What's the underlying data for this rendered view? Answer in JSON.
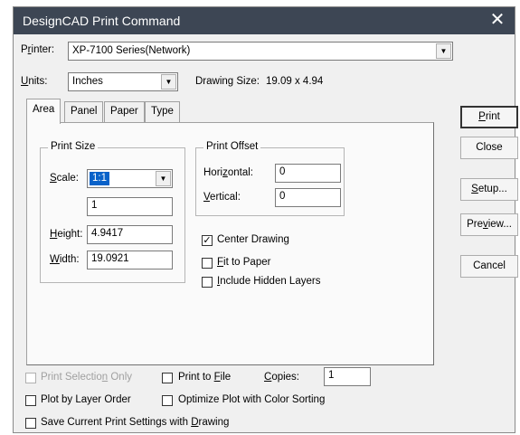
{
  "window": {
    "title": "DesignCAD Print Command",
    "close_glyph": "✕"
  },
  "printer": {
    "label_pre": "P",
    "label_u": "r",
    "label_post": "inter:",
    "value": "XP-7100 Series(Network)"
  },
  "units": {
    "label_u": "U",
    "label_post": "nits:",
    "value": "Inches"
  },
  "drawing_size": {
    "label": "Drawing Size:",
    "value": "19.09 x 4.94"
  },
  "tabs": [
    {
      "label": "Area",
      "active": true
    },
    {
      "label": "Panel",
      "active": false
    },
    {
      "label": "Paper",
      "active": false
    },
    {
      "label": "Type",
      "active": false
    }
  ],
  "print_size": {
    "legend": "Print Size",
    "scale": {
      "label_u": "S",
      "label_post": "cale:",
      "value": "1:1"
    },
    "ratio_value": "1",
    "height": {
      "label_u": "H",
      "label_post": "eight:",
      "value": "4.9417"
    },
    "width": {
      "label_u": "W",
      "label_post": "idth:",
      "value": "19.0921"
    }
  },
  "print_offset": {
    "legend": "Print Offset",
    "horizontal": {
      "label_pre": "Hori",
      "label_u": "z",
      "label_post": "ontal:",
      "value": "0"
    },
    "vertical": {
      "label_u": "V",
      "label_post": "ertical:",
      "value": "0"
    }
  },
  "options": {
    "center_drawing": {
      "label": "Center Drawing",
      "checked": true
    },
    "fit_to_paper": {
      "label_u": "F",
      "label_post": "it to Paper",
      "checked": false
    },
    "include_hidden": {
      "label_u": "I",
      "label_post": "nclude Hidden Layers",
      "checked": false
    }
  },
  "buttons": {
    "print": {
      "label_u": "P",
      "label_post": "rint"
    },
    "close": {
      "label": "Close"
    },
    "setup": {
      "label_u": "S",
      "label_post": "etup..."
    },
    "preview": {
      "label_pre": "Pre",
      "label_u": "v",
      "label_post": "iew..."
    },
    "cancel": {
      "label": "Cancel"
    }
  },
  "bottom": {
    "print_selection": {
      "label_pre": "Print Selectio",
      "label_u": "n",
      "label_post": " Only",
      "checked": false,
      "disabled": true
    },
    "print_to_file": {
      "label_pre": "Print to ",
      "label_u": "F",
      "label_post": "ile",
      "checked": false
    },
    "copies": {
      "label_u": "C",
      "label_post": "opies:",
      "value": "1"
    },
    "plot_by_layer": {
      "label": "Plot by Layer Order",
      "checked": false
    },
    "optimize_plot": {
      "label": "Optimize Plot with Color Sorting",
      "checked": false
    },
    "save_settings": {
      "label_pre": "Save Current Print Settings with ",
      "label_u": "D",
      "label_post": "rawing",
      "checked": false
    }
  },
  "icons": {
    "dropdown_arrow": "▼",
    "check_mark": "✓"
  }
}
